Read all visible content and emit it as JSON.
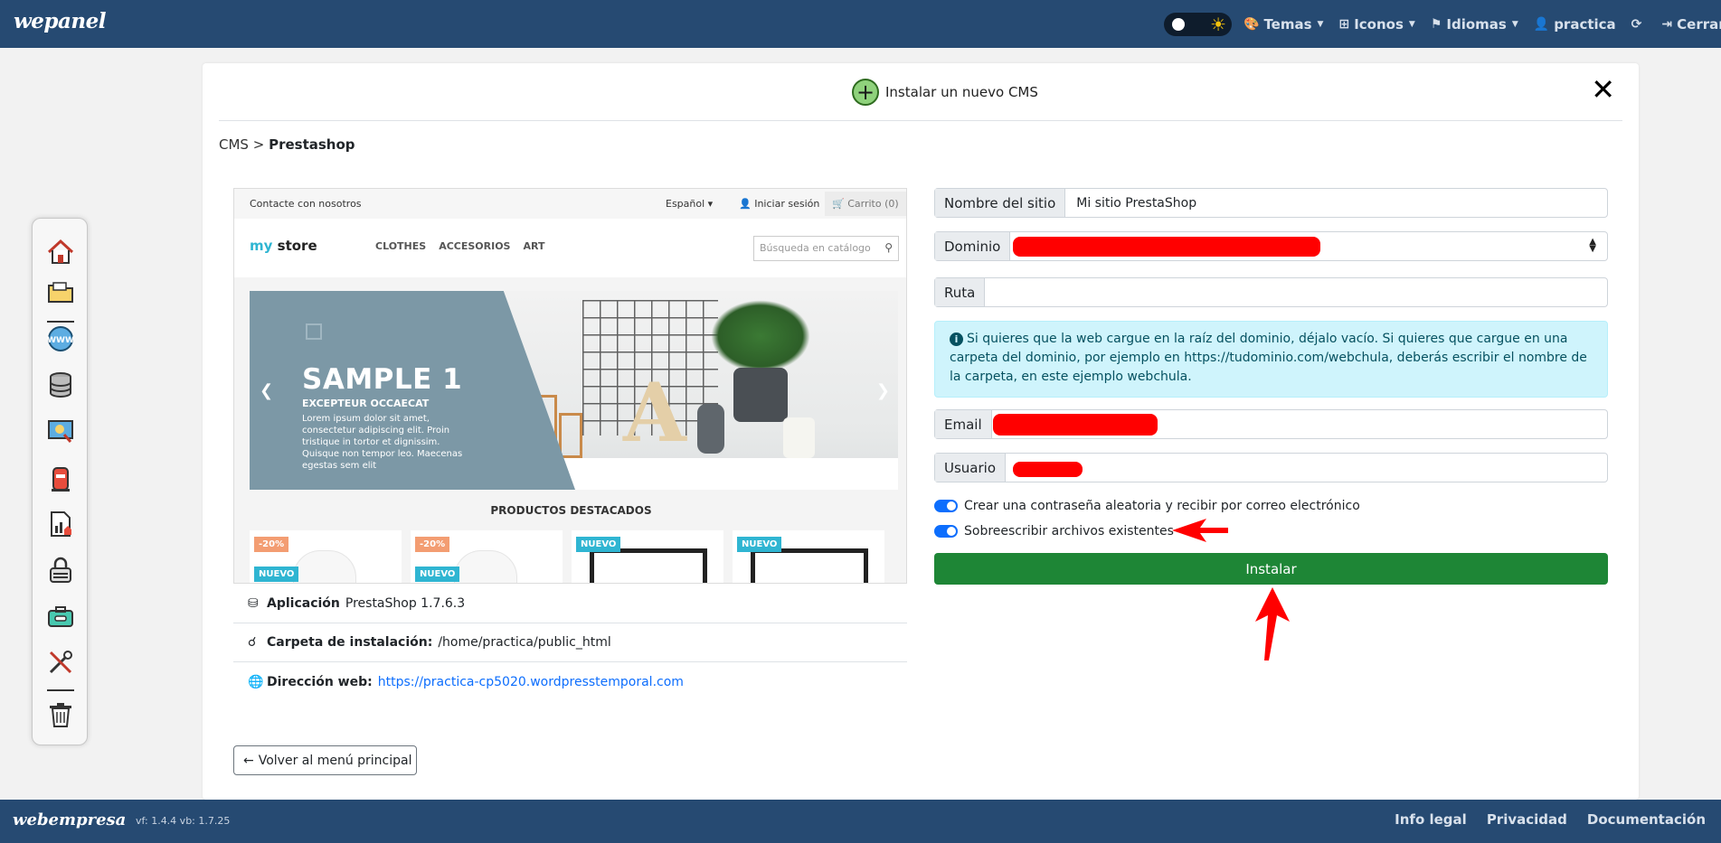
{
  "topbar": {
    "logo": "wepanel",
    "nav": [
      {
        "icon": "palette-icon",
        "glyph": "🎨",
        "label": "Temas",
        "caret": true
      },
      {
        "icon": "icons-icon",
        "glyph": "⊞",
        "label": "Iconos",
        "caret": true
      },
      {
        "icon": "flag-icon",
        "glyph": "⚑",
        "label": "Idiomas",
        "caret": true
      },
      {
        "icon": "user-cog-icon",
        "glyph": "👤",
        "label": "practica",
        "caret": false
      },
      {
        "icon": "refresh-icon",
        "glyph": "⟳",
        "label": "",
        "caret": false
      },
      {
        "icon": "logout-icon",
        "glyph": "⇥",
        "label": "Cerrar sesión",
        "caret": false
      }
    ]
  },
  "modal": {
    "title": "Instalar un nuevo CMS",
    "close": "✕",
    "breadcrumb_root": "CMS",
    "breadcrumb_sep": ">",
    "breadcrumb_current": "Prestashop"
  },
  "preview": {
    "contact": "Contacte con nosotros",
    "language": "Español ▾",
    "login": "Iniciar sesión",
    "cart": "Carrito (0)",
    "logo_a": "my",
    "logo_b": " store",
    "menu": [
      "CLOTHES",
      "ACCESORIOS",
      "ART"
    ],
    "search_placeholder": "Búsqueda en catálogo",
    "slide_title": "SAMPLE 1",
    "slide_subtitle": "EXCEPTEUR OCCAECAT",
    "slide_text": "Lorem ipsum dolor sit amet, consectetur adipiscing elit. Proin tristique in tortor et dignissim. Quisque non tempor leo. Maecenas egestas sem elit",
    "featured": "PRODUCTOS DESTACADOS",
    "products": [
      {
        "tag": "-20%",
        "tag2": "NUEVO"
      },
      {
        "tag": "-20%",
        "tag2": "NUEVO"
      },
      {
        "tag": "NUEVO"
      },
      {
        "tag": "NUEVO"
      }
    ]
  },
  "info": {
    "app_label": "Aplicación",
    "app_value": "PrestaShop 1.7.6.3",
    "folder_label": "Carpeta de instalación:",
    "folder_value": "/home/practica/public_html",
    "url_label": "Dirección web:",
    "url_value": "https://practica-cp5020.wordpresstemporal.com"
  },
  "back_button": "Volver al menú principal",
  "form": {
    "site_name_label": "Nombre del sitio",
    "site_name_value": "Mi sitio PrestaShop",
    "domain_label": "Dominio",
    "path_label": "Ruta",
    "path_value": "",
    "alert_text": "Si quieres que la web cargue en la raíz del dominio, déjalo vacío. Si quieres que cargue en una carpeta del dominio, por ejemplo en https://tudominio.com/webchula, deberás escribir el nombre de la carpeta, en este ejemplo webchula.",
    "email_label": "Email",
    "user_label": "Usuario",
    "switch_password": "Crear una contraseña aleatoria y recibir por correo electrónico",
    "switch_overwrite": "Sobreescribir archivos existentes",
    "install_button": "Instalar"
  },
  "footer": {
    "logo": "webempresa",
    "version": "vf: 1.4.4  vb: 1.7.25",
    "links": [
      "Info legal",
      "Privacidad",
      "Documentación"
    ]
  },
  "colors": {
    "navbar": "#264a72",
    "install": "#1e8636",
    "alert_bg": "#cff4fc",
    "redaction": "#ff0000",
    "annotation_arrow": "#ff0000"
  }
}
